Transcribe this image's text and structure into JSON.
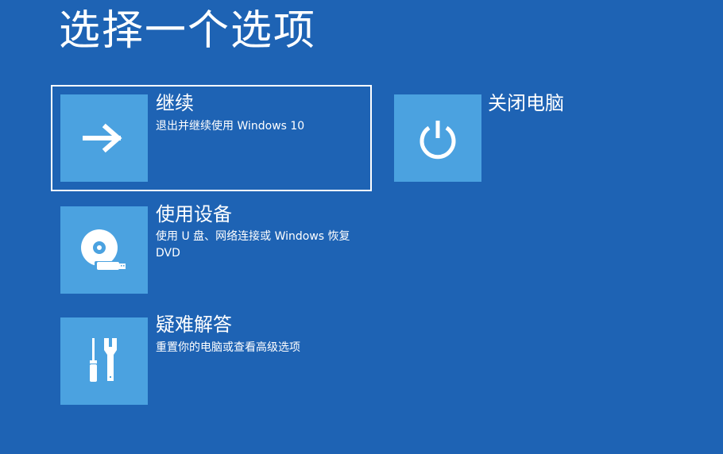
{
  "page": {
    "title": "选择一个选项"
  },
  "options": [
    {
      "title": "继续",
      "description": "退出并继续使用 Windows 10",
      "icon": "arrow-right-icon",
      "selected": true
    },
    {
      "title": "关闭电脑",
      "description": "",
      "icon": "power-icon",
      "selected": false
    },
    {
      "title": "使用设备",
      "description": "使用 U 盘、网络连接或 Windows 恢复 DVD",
      "icon": "disc-usb-icon",
      "selected": false
    },
    {
      "title": "疑难解答",
      "description": "重置你的电脑或查看高级选项",
      "icon": "tools-icon",
      "selected": false
    }
  ],
  "colors": {
    "background": "#1e63b4",
    "tile": "#4ba2e0",
    "text": "#ffffff"
  }
}
